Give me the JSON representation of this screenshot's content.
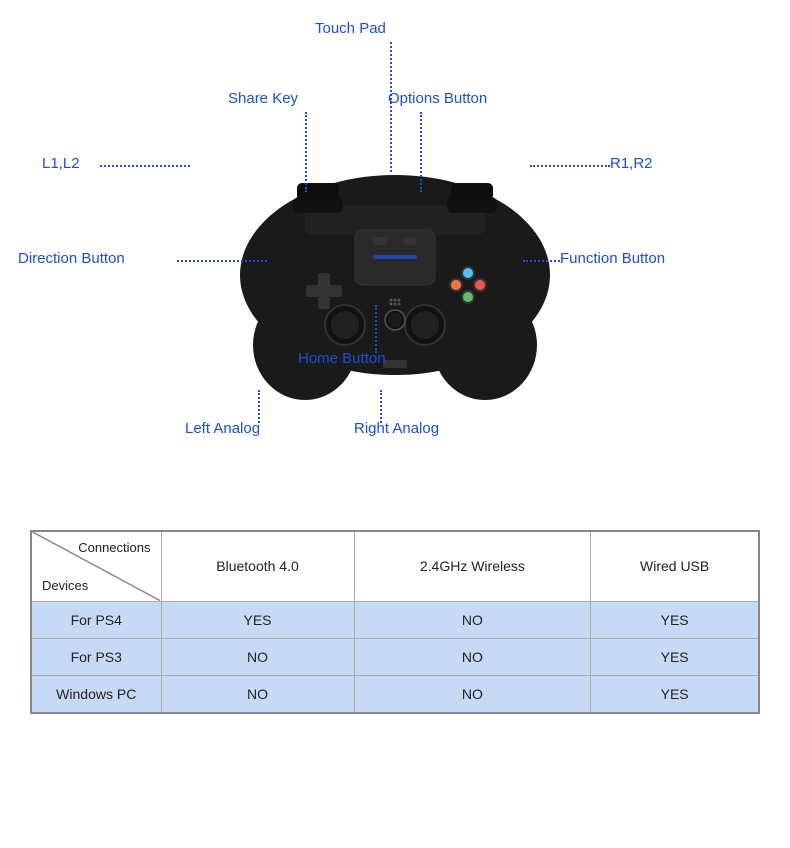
{
  "labels": {
    "touchpad": "Touch Pad",
    "sharekey": "Share Key",
    "options": "Options Button",
    "l1l2": "L1,L2",
    "r1r2": "R1,R2",
    "direction": "Direction Button",
    "function": "Function Button",
    "home": "Home Button",
    "leftanalog": "Left Analog",
    "rightanalog": "Right Analog"
  },
  "table": {
    "diagonal_top": "Connections",
    "diagonal_bottom": "Devices",
    "columns": [
      "Bluetooth 4.0",
      "2.4GHz Wireless",
      "Wired USB"
    ],
    "rows": [
      {
        "device": "For PS4",
        "cols": [
          "YES",
          "NO",
          "YES"
        ]
      },
      {
        "device": "For PS3",
        "cols": [
          "NO",
          "NO",
          "YES"
        ]
      },
      {
        "device": "Windows PC",
        "cols": [
          "NO",
          "NO",
          "YES"
        ]
      }
    ]
  }
}
